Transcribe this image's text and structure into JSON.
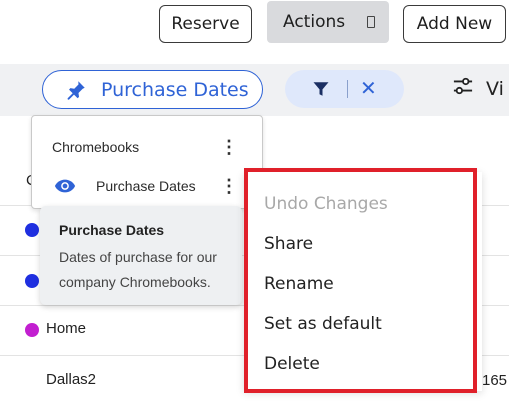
{
  "toolbar": {
    "reserve_label": "Reserve",
    "actions_label": "Actions",
    "add_new_label": "Add New"
  },
  "filters": {
    "active_view_label": "Purchase Dates",
    "views_label": "Vi"
  },
  "view_menu": {
    "items": [
      {
        "label": "Chromebooks"
      },
      {
        "label": "Purchase Dates"
      }
    ]
  },
  "tooltip": {
    "title": "Purchase Dates",
    "body": "Dates of purchase for our company Chromebooks."
  },
  "context_menu": {
    "items": [
      {
        "label": "Undo Changes",
        "disabled": true
      },
      {
        "label": "Share"
      },
      {
        "label": "Rename"
      },
      {
        "label": "Set as default"
      },
      {
        "label": "Delete"
      }
    ]
  },
  "table": {
    "rows": [
      {
        "label": "Home",
        "dot_color": "#c21fd0"
      },
      {
        "label": "Dallas2",
        "value": "165"
      }
    ],
    "partial_header": "C"
  },
  "colors": {
    "accent": "#2f63d6",
    "highlight_border": "#e0202a",
    "row_dot_blue": "#1f2fe0",
    "row_dot_purple": "#c21fd0"
  }
}
